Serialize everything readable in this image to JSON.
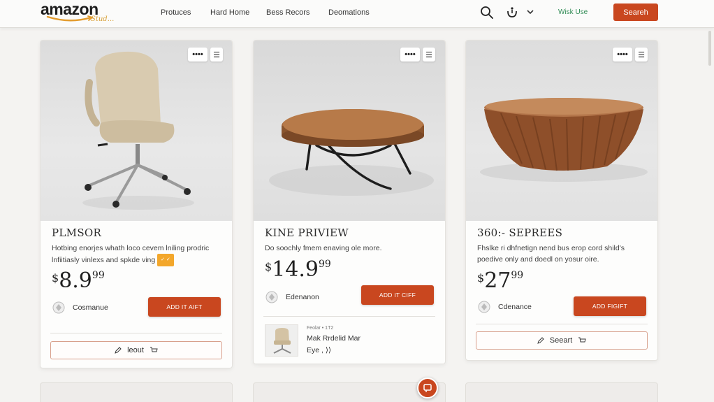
{
  "header": {
    "logo_word": "amazon",
    "logo_sub": "Stud...",
    "nav": [
      "Protuces",
      "Hard Home",
      "Bess Recors",
      "Deomations"
    ],
    "visit_link": "Wisk Use",
    "search_button": "Seareh"
  },
  "products": [
    {
      "title": "PLMSOR",
      "description": "Hotbing enorjes whath loco cevem lniling prodric lnfiitiasly vinlexs and spkde ving",
      "badge": "✓ ✓",
      "price_currency": "$",
      "price_main": "8.9",
      "price_cents": "99",
      "seller": "Cosmanue",
      "add_button": "ADD IT AIFT",
      "secondary_button": "leout"
    },
    {
      "title": "KINE PRIVIEW",
      "description": "Do soochly fmem enaving ole more.",
      "price_currency": "$",
      "price_main": "14.9",
      "price_cents": "99",
      "seller": "Edenanon",
      "add_button": "ADD IT CIFF",
      "recommend_small": "Feolar • 1T2",
      "recommend_title": "Mak Rrdelid Mar",
      "recommend_sub": "Eye ,"
    },
    {
      "title": "360:- SEPREES",
      "description": "Fhslke ri dhfnetign nend bus erop cord shild's poedive only and doedl on yosur oire.",
      "price_currency": "$",
      "price_main": "27",
      "price_cents": "99",
      "seller": "Cdenance",
      "add_button": "ADD FIGIFT",
      "secondary_button": "Seeart"
    }
  ],
  "card_menu": {
    "dots": "••••",
    "lines": "☰"
  },
  "colors": {
    "accent": "#c9471f",
    "background": "#f4f3f1",
    "link_green": "#2f8b54",
    "badge": "#f3a72b"
  }
}
